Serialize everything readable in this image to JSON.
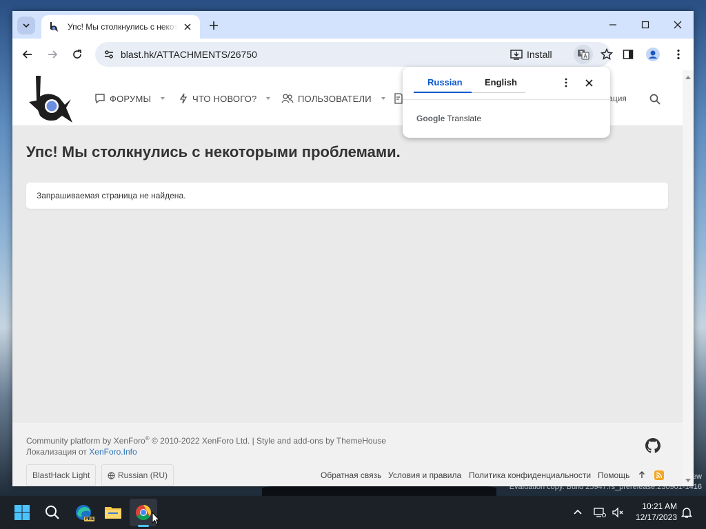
{
  "browser": {
    "tab": {
      "title": "Упс! Мы столкнулись с некоторыми проблемами."
    },
    "address_bar": {
      "url": "blast.hk/ATTACHMENTS/26750"
    },
    "install_label": "Install"
  },
  "translate_popup": {
    "source_language": "Russian",
    "target_language": "English",
    "brand_google": "Google",
    "brand_translate": "Translate"
  },
  "site": {
    "nav": [
      {
        "label": "ФОРУМЫ"
      },
      {
        "label": "ЧТО НОВОГО?"
      },
      {
        "label": "ПОЛЬЗОВАТЕЛИ"
      }
    ],
    "nav_partial": "трация"
  },
  "page": {
    "title": "Упс! Мы столкнулись с некоторыми проблемами.",
    "message": "Запрашиваемая страница не найдена."
  },
  "footer": {
    "copyright": "Community platform by XenForo",
    "copyright_mark": "®",
    "copyright_rest": " © 2010-2022 XenForo Ltd. | Style and add-ons by ThemeHouse",
    "localization_prefix": "Локализация от ",
    "localization_link": "XenForo.Info",
    "style_chooser": "BlastHack Light",
    "language_chooser": "Russian (RU)",
    "links": [
      "Обратная связь",
      "Условия и правила",
      "Политика конфиденциальности",
      "Помощь"
    ]
  },
  "desktop": {
    "watermark_partial": "ew",
    "watermark_build": "Evaluation copy. Build 25947.rs_prerelease.230901-1416"
  },
  "taskbar": {
    "time": "10:21 AM",
    "date": "12/17/2023",
    "edge_badge": "PRE"
  },
  "colors": {
    "accent": "#0b57d0",
    "tabstrip": "#d3e3fd",
    "link": "#2f75b6",
    "rss": "#f5a623"
  }
}
